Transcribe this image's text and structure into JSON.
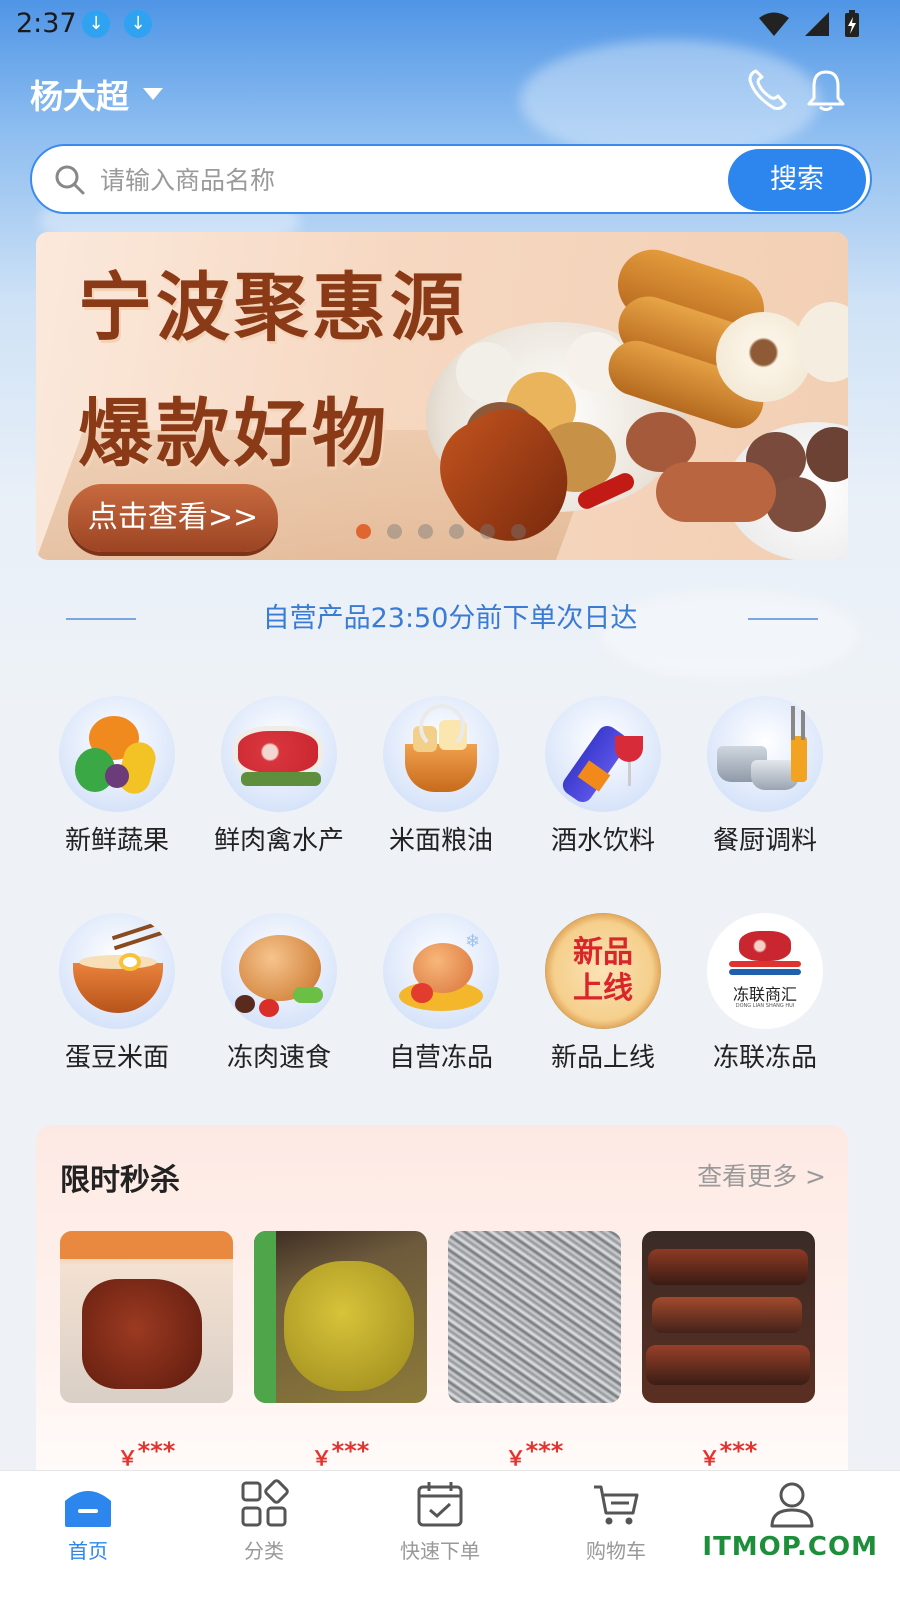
{
  "status_bar": {
    "time": "2:37"
  },
  "header": {
    "user_name": "杨大超"
  },
  "search": {
    "placeholder": "请输入商品名称",
    "button_label": "搜索"
  },
  "banner": {
    "line1": "宁波聚惠源",
    "line2": "爆款好物",
    "button_label": "点击查看>>",
    "dot_count": 6,
    "active_dot": 0
  },
  "notice": {
    "text": "自营产品23:50分前下单次日达"
  },
  "categories": [
    {
      "label": "新鲜蔬果",
      "icon": "vegetables-icon"
    },
    {
      "label": "鲜肉禽水产",
      "icon": "meat-icon"
    },
    {
      "label": "米面粮油",
      "icon": "grain-basket-icon"
    },
    {
      "label": "酒水饮料",
      "icon": "wine-icon"
    },
    {
      "label": "餐厨调料",
      "icon": "cookware-icon"
    },
    {
      "label": "蛋豆米面",
      "icon": "noodle-bowl-icon"
    },
    {
      "label": "冻肉速食",
      "icon": "roast-chicken-icon"
    },
    {
      "label": "自营冻品",
      "icon": "frozen-chicken-icon"
    },
    {
      "label": "新品上线",
      "icon": "new-product-badge-icon",
      "badge_text": "新品上线"
    },
    {
      "label": "冻联冻品",
      "icon": "donglian-logo-icon",
      "logo_text": "冻联商汇",
      "logo_subtext": "DONG LIAN SHANG HUI"
    }
  ],
  "flash_sale": {
    "title": "限时秒杀",
    "more_label": "查看更多 >",
    "products": [
      {
        "image": "braised-pork-image",
        "currency": "￥",
        "price": "***"
      },
      {
        "image": "salted-chicken-image",
        "currency": "￥",
        "price": "***"
      },
      {
        "image": "dried-fish-image",
        "currency": "￥",
        "price": "***"
      },
      {
        "image": "cured-meat-image",
        "currency": "￥",
        "price": "***"
      }
    ]
  },
  "bottom_nav": [
    {
      "label": "首页",
      "icon": "home-icon",
      "active": true
    },
    {
      "label": "分类",
      "icon": "category-grid-icon",
      "active": false
    },
    {
      "label": "快速下单",
      "icon": "quick-order-icon",
      "active": false
    },
    {
      "label": "购物车",
      "icon": "cart-icon",
      "active": false
    },
    {
      "label": "",
      "icon": "profile-icon",
      "active": false
    }
  ],
  "watermark": "ITMOP.COM",
  "colors": {
    "primary": "#2d86ee",
    "price": "#e5322d",
    "banner_text": "#8a3a17",
    "banner_button": "#b5572f"
  }
}
